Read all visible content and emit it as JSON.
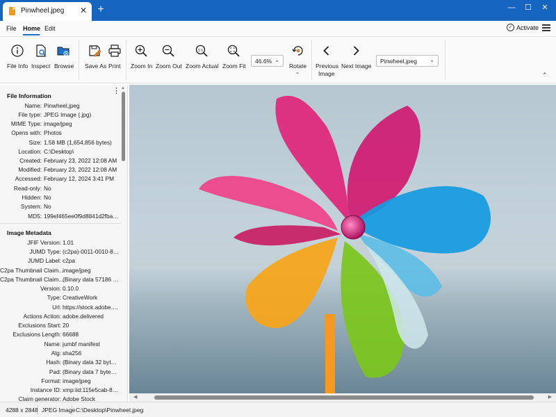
{
  "window": {
    "tab_title": "Pinwheel.jpeg",
    "tab_close": "✕",
    "new_tab": "+",
    "minimize": "—",
    "maximize": "☐",
    "close": "✕"
  },
  "menu": {
    "items": [
      "File",
      "Home",
      "Edit"
    ],
    "active": "Home",
    "activate_label": "Activate"
  },
  "ribbon": {
    "file_info": "File Info",
    "inspect": "Inspect",
    "browse": "Browse",
    "save_as": "Save As",
    "print": "Print",
    "zoom_in": "Zoom In",
    "zoom_out": "Zoom Out",
    "zoom_actual": "Zoom Actual",
    "zoom_fit": "Zoom Fit",
    "zoom_value": "46.6%",
    "rotate": "Rotate",
    "previous_line1": "Previous",
    "previous_line2": "Image",
    "next_image": "Next Image",
    "image_select": "Pinwheel.jpeg",
    "collapse_icon": "chevron-up-icon"
  },
  "file_information": {
    "title": "File Information",
    "rows": [
      {
        "k": "Name:",
        "v": "Pinwheel.jpeg"
      },
      {
        "k": "File type:",
        "v": "JPEG Image (.jpg)"
      },
      {
        "k": "MIME Type:",
        "v": "image/jpeg"
      },
      {
        "k": "Opens with:",
        "v": "Photos"
      },
      {
        "k": "Size:",
        "v": "1.58 MB (1,654,856 bytes)"
      },
      {
        "k": "Location:",
        "v": "C:\\Desktop\\"
      },
      {
        "k": "Created:",
        "v": "February 23, 2022 12:08 AM"
      },
      {
        "k": "Modified:",
        "v": "February 23, 2022 12:08 AM"
      },
      {
        "k": "Accessed:",
        "v": "February 12, 2024 3:41 PM"
      },
      {
        "k": "Read-only:",
        "v": "No"
      },
      {
        "k": "Hidden:",
        "v": "No"
      },
      {
        "k": "System:",
        "v": "No"
      },
      {
        "k": "MD5:",
        "v": "199ef465ee0f9d8841d2fba4..."
      }
    ]
  },
  "image_metadata": {
    "title": "Image Metadata",
    "rows": [
      {
        "k": "JFIF Version:",
        "v": "1.01"
      },
      {
        "k": "JUMD Type:",
        "v": "(c2pa)-0011-0010-80..."
      },
      {
        "k": "JUMD Label:",
        "v": "c2pa"
      },
      {
        "k": "C2pa Thumbnail Claim...",
        "v": "image/jpeg"
      },
      {
        "k": "C2pa Thumbnail Claim...",
        "v": "(Binary data 57186 b..."
      },
      {
        "k": "Version:",
        "v": "0.10.0"
      },
      {
        "k": "Type:",
        "v": "CreativeWork"
      },
      {
        "k": "Url:",
        "v": "https://stock.adobe.c..."
      },
      {
        "k": "Actions Action:",
        "v": "adobe.delivered"
      },
      {
        "k": "Exclusions Start:",
        "v": "20"
      },
      {
        "k": "Exclusions Length:",
        "v": "66688"
      },
      {
        "k": "Name:",
        "v": "jumbf manifest"
      },
      {
        "k": "Alg:",
        "v": "sha256"
      },
      {
        "k": "Hash:",
        "v": "(Binary data 32 bytes..."
      },
      {
        "k": "Pad:",
        "v": "(Binary data 7 bytes,..."
      },
      {
        "k": "Format:",
        "v": "image/jpeg"
      },
      {
        "k": "Instance ID:",
        "v": "xmp:iid:115e5cab-86..."
      },
      {
        "k": "Claim generator:",
        "v": "Adobe Stock"
      }
    ]
  },
  "status": {
    "dimensions": "4288 x 2848",
    "type": "JPEG Image",
    "path": "C:\\Desktop\\Pinwheel.jpeg"
  },
  "colors": {
    "titlebar": "#1565c0",
    "accent": "#1e88e5",
    "ribbon_icon_blue": "#1e72c8",
    "ribbon_icon_orange": "#e67e22"
  }
}
